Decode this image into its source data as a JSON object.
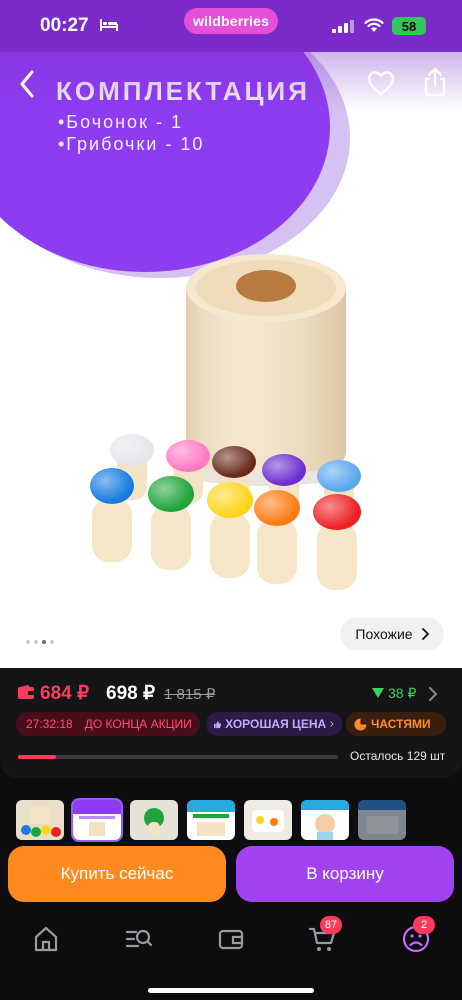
{
  "status_bar": {
    "time": "00:27",
    "brand": "wildberries",
    "battery": "58"
  },
  "hero": {
    "promo_title": "КОМПЛЕКТАЦИЯ",
    "promo_lines": [
      "•Бочонок - 1",
      "•Грибочки - 10"
    ],
    "similar_label": "Похожие",
    "image_count": 4,
    "active_image": 2
  },
  "price": {
    "wallet_price": "684 ₽",
    "main_price": "698 ₽",
    "old_price": "1 815 ₽",
    "bonus": "38 ₽",
    "timer": "27:32:18",
    "timer_label": "ДО КОНЦА АКЦИИ",
    "good_price_label": "ХОРОШАЯ ЦЕНА",
    "parts_label": "ЧАСТЯМИ",
    "stock_label": "Осталось 129 шт",
    "stock_fraction": 0.12
  },
  "actions": {
    "buy_now": "Купить сейчас",
    "add_to_cart": "В корзину"
  },
  "tabs": {
    "cart_count": "87",
    "profile_count": "2"
  },
  "colors": {
    "accent": "#a142f0",
    "buy": "#ff8a1f",
    "sale": "#ff3b5c",
    "bonus": "#3ed061"
  }
}
